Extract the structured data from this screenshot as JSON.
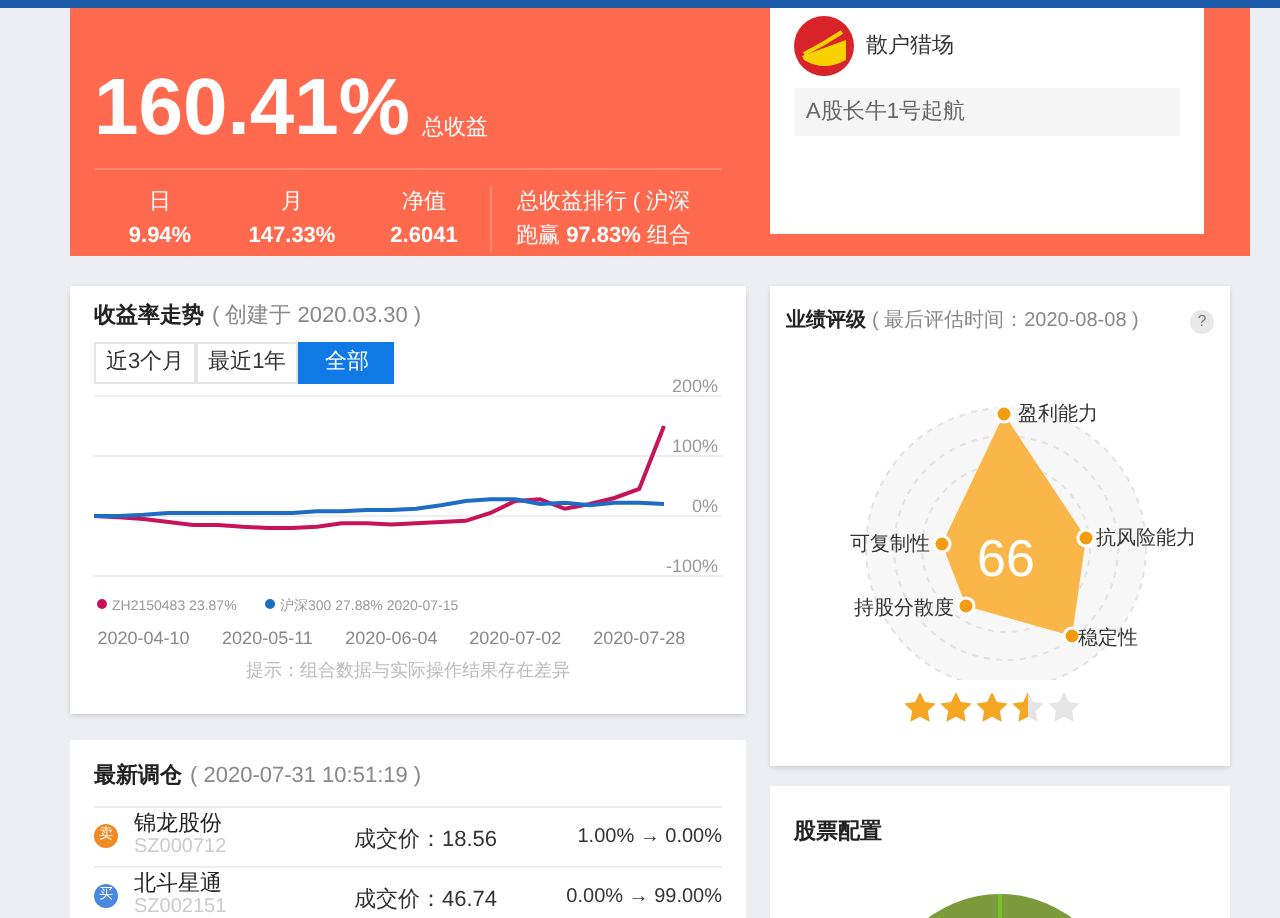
{
  "summary": {
    "total_return": "160.41%",
    "total_label": "总收益",
    "stats": [
      {
        "label": "日",
        "value": "9.94%"
      },
      {
        "label": "月",
        "value": "147.33%"
      },
      {
        "label": "净值",
        "value": "2.6041"
      }
    ],
    "rank_label": "总收益排行 ( 沪深",
    "rank_text": "跑赢 **97.83%** 组合"
  },
  "profile": {
    "name": "散户猎场",
    "motto": "A股长牛1号起航"
  },
  "trend": {
    "title": "收益率走势",
    "subtitle": "( 创建于 2020.03.30 )",
    "tabs": [
      {
        "label": "近3个月",
        "selected": false
      },
      {
        "label": "最近1年",
        "selected": false
      },
      {
        "label": "全部",
        "selected": true
      }
    ],
    "chart_data": {
      "type": "line",
      "categories": [
        null,
        null,
        "2020-04-10",
        null,
        null,
        null,
        null,
        "2020-05-11",
        null,
        null,
        null,
        null,
        "2020-06-04",
        null,
        null,
        null,
        null,
        "2020-07-02",
        null,
        null,
        null,
        null,
        "2020-07-28",
        null
      ],
      "ylim": [
        -100,
        200
      ],
      "legend": "bottom",
      "yticks": [
        {
          "value": 200,
          "label": "200%"
        },
        {
          "value": 100,
          "label": "100%"
        },
        {
          "value": 0,
          "label": "0%"
        },
        {
          "value": -100,
          "label": "-100%"
        }
      ],
      "series": [
        {
          "name": "ZH2150483",
          "color": "#c8135a",
          "values": [
            0,
            -2,
            -5,
            -10,
            -15,
            -15,
            -18,
            -20,
            -20,
            -18,
            -12,
            -12,
            -14,
            -12,
            -10,
            -8,
            5,
            25,
            28,
            12,
            20,
            30,
            45,
            150
          ]
        },
        {
          "name": "沪深300",
          "color": "#1f6cc4",
          "values": [
            0,
            0,
            2,
            5,
            5,
            5,
            5,
            5,
            5,
            8,
            8,
            10,
            10,
            12,
            18,
            25,
            28,
            28,
            20,
            22,
            18,
            22,
            22,
            20
          ]
        }
      ]
    },
    "legend": [
      {
        "reading": "23.87%"
      },
      {
        "reading": "27.88% 2020-07-15"
      }
    ],
    "note": "提示：组合数据与实际操作结果存在差异"
  },
  "rating": {
    "title": "业绩评级",
    "subtitle": "( 最后评估时间：2020-08-08 )",
    "help": "?",
    "score": "66",
    "axes": [
      "盈利能力",
      "抗风险能力",
      "稳定性",
      "持股分散度",
      "可复制性"
    ],
    "stars": 3.5
  },
  "trades": {
    "title": "最新调仓",
    "subtitle": "( 2020-07-31 10:51:19 )",
    "rows": [
      {
        "side": "卖",
        "color": "#f08a24",
        "name": "锦龙股份",
        "code": "SZ000712",
        "price": "成交价：18.56",
        "change": "1.00% → 0.00%"
      },
      {
        "side": "买",
        "color": "#4a87e0",
        "name": "北斗星通",
        "code": "SZ002151",
        "price": "成交价：46.74",
        "change": "0.00% → 99.00%"
      }
    ]
  },
  "allocation": {
    "title": "股票配置"
  }
}
